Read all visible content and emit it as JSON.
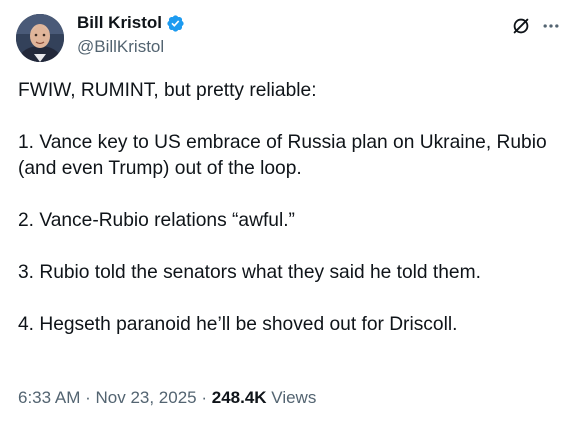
{
  "author": {
    "display_name": "Bill Kristol",
    "handle": "@BillKristol",
    "verified": true,
    "avatar_icon": "profile-photo"
  },
  "header_actions": {
    "grok_icon": "grok-icon",
    "more_icon": "more-options-icon"
  },
  "body": {
    "paragraphs": [
      "FWIW, RUMINT, but pretty reliable:",
      "1. Vance key to US embrace of Russia plan on Ukraine, Rubio (and even Trump) out of the loop.",
      "2. Vance-Rubio relations “awful.”",
      "3. Rubio told the senators what they said he told them.",
      "4. Hegseth paranoid he’ll be shoved out for Driscoll."
    ]
  },
  "meta": {
    "time": "6:33 AM",
    "separator": " · ",
    "date": "Nov 23, 2025",
    "views_count": "248.4K",
    "views_label": "Views"
  },
  "colors": {
    "text_primary": "#0f1419",
    "text_secondary": "#536471",
    "verified_blue": "#1d9bf0"
  }
}
